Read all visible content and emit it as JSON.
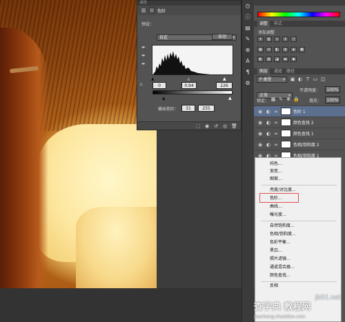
{
  "properties_panel": {
    "header_label": "属性",
    "panel_title": "色阶",
    "preset_label": "预设：",
    "preset_value": "自定",
    "channel_value": "红",
    "auto_button": "自动",
    "input_levels": {
      "black": "0",
      "mid": "0.94",
      "white": "226"
    },
    "output_label": "输出色阶：",
    "output_levels": {
      "black": "31",
      "white": "255"
    }
  },
  "right_panel": {
    "adjust_tabs": [
      "调整",
      "样式"
    ],
    "add_adjustment_label": "添加调整",
    "layer_tabs": [
      "图层",
      "通道",
      "路径"
    ],
    "kind_filter": "P 类型",
    "blend_mode": "正常",
    "opacity_label": "不透明度：",
    "opacity_value": "100%",
    "lock_label": "锁定：",
    "fill_label": "填充：",
    "fill_value": "100%",
    "layers": [
      {
        "name": "色阶 1",
        "selected": true
      },
      {
        "name": "颜色查找 2",
        "selected": false
      },
      {
        "name": "颜色查找 1",
        "selected": false
      },
      {
        "name": "色相/饱和度 2",
        "selected": false
      },
      {
        "name": "色相/饱和度 1",
        "selected": false
      }
    ]
  },
  "menu": {
    "items": [
      "纯色...",
      "渐变...",
      "图案...",
      "亮度/对比度...",
      "色阶...",
      "曲线...",
      "曝光度...",
      "自然饱和度...",
      "色相/饱和度...",
      "色彩平衡...",
      "黑白...",
      "照片滤镜...",
      "通道混合器...",
      "颜色查找...",
      "反相"
    ],
    "highlighted": "色阶..."
  },
  "watermark": {
    "line1": "查字典 教程网",
    "url": "jb51.net",
    "site": "jiaocheng.chazidian.com"
  },
  "colors": {
    "selected_layer": "#5c6f8e",
    "panel_bg": "#535353",
    "highlight_box": "#e05050"
  }
}
